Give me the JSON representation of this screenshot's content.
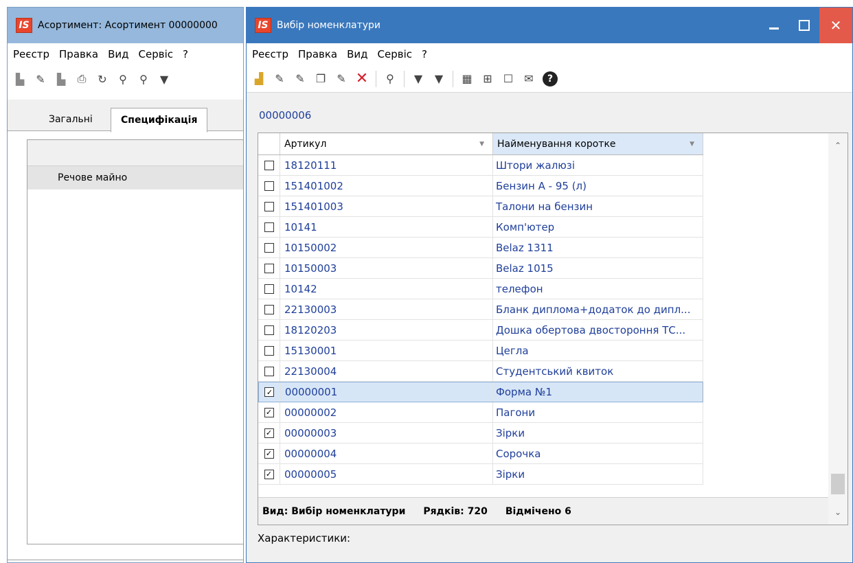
{
  "background_window": {
    "title": "Асортимент: Асортимент 00000000",
    "logo": "IS",
    "menu": [
      "Реєстр",
      "Правка",
      "Вид",
      "Сервіс",
      "?"
    ],
    "tabs": {
      "general": "Загальні",
      "specification": "Специфікація"
    },
    "row_label": "Речове майно"
  },
  "dialog": {
    "title": "Вибір номенклатури",
    "logo": "IS",
    "menu": [
      "Реєстр",
      "Правка",
      "Вид",
      "Сервіс",
      "?"
    ],
    "code": "00000006",
    "columns": {
      "article": "Артикул",
      "name": "Найменування коротке"
    },
    "rows": [
      {
        "article": "18120111",
        "name": "Штори жалюзі",
        "checked": false
      },
      {
        "article": "151401002",
        "name": "Бензин А - 95 (л)",
        "checked": false
      },
      {
        "article": "151401003",
        "name": "Талони на бензин",
        "checked": false
      },
      {
        "article": "10141",
        "name": "Комп'ютер",
        "checked": false
      },
      {
        "article": "10150002",
        "name": "Belaz 1311",
        "checked": false
      },
      {
        "article": "10150003",
        "name": "Belaz 1015",
        "checked": false
      },
      {
        "article": "10142",
        "name": "телефон",
        "checked": false
      },
      {
        "article": "22130003",
        "name": "Бланк диплома+додаток до дипл...",
        "checked": false
      },
      {
        "article": "18120203",
        "name": "Дошка обертова двостороння ТС...",
        "checked": false
      },
      {
        "article": "15130001",
        "name": "Цегла",
        "checked": false
      },
      {
        "article": "22130004",
        "name": "Студентський квиток",
        "checked": false
      },
      {
        "article": "00000001",
        "name": "Форма №1",
        "checked": true,
        "selected": true
      },
      {
        "article": "00000002",
        "name": "Пагони",
        "checked": true
      },
      {
        "article": "00000003",
        "name": "Зірки",
        "checked": true
      },
      {
        "article": "00000004",
        "name": "Сорочка",
        "checked": true
      },
      {
        "article": "00000005",
        "name": "Зірки",
        "checked": true
      }
    ],
    "status": {
      "view": "Вид: Вибір номенклатури",
      "rows": "Рядків: 720",
      "marked": "Відмічено 6"
    },
    "characteristics_label": "Характеристики:"
  },
  "colors": {
    "title_bar": "#3a78bd",
    "link_text": "#1f3f9a",
    "close_button": "#e35a4b",
    "selected_row": "#d7e6f7"
  }
}
